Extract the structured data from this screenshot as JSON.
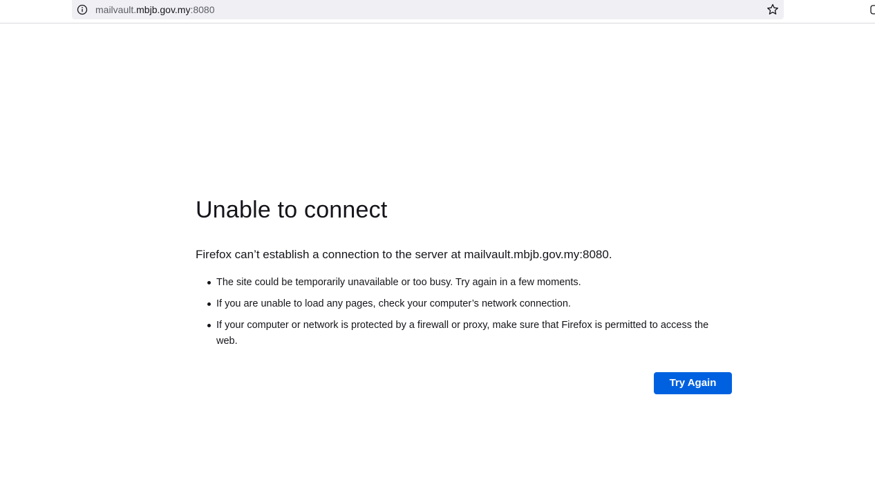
{
  "browser": {
    "url_prefix": "mailvault.",
    "url_host": "mbjb.gov.my",
    "url_suffix": ":8080",
    "icons": {
      "site_info": "info-icon",
      "bookmark": "star-icon"
    }
  },
  "error": {
    "title": "Unable to connect",
    "description": "Firefox can’t establish a connection to the server at mailvault.mbjb.gov.my:8080.",
    "tips": [
      "The site could be temporarily unavailable or too busy. Try again in a few moments.",
      "If you are unable to load any pages, check your computer’s network connection.",
      "If your computer or network is protected by a firewall or proxy, make sure that Firefox is permitted to access the web."
    ],
    "button_label": "Try Again"
  },
  "colors": {
    "button": "#0061e0",
    "text": "#15141a",
    "urlbar": "#f0f0f4"
  }
}
